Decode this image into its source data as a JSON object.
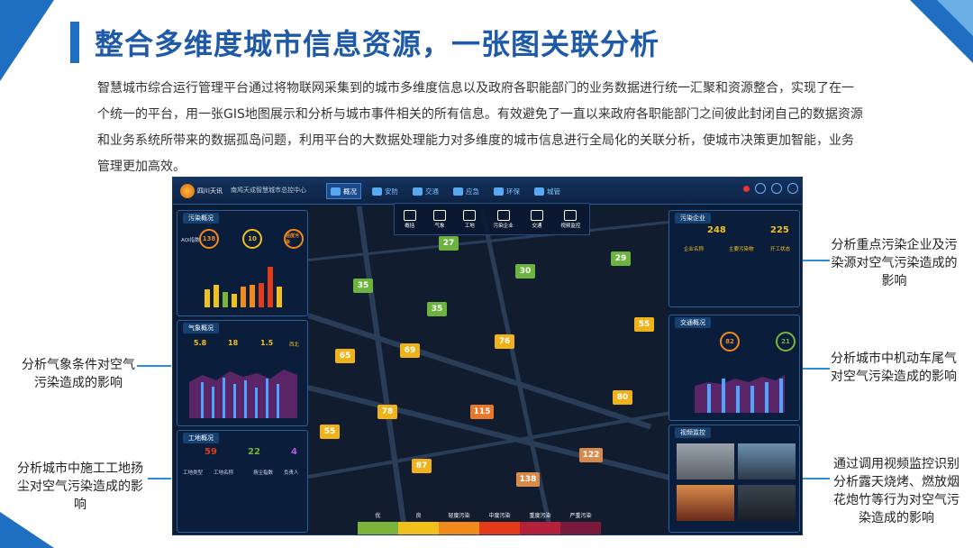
{
  "title": "整合多维度城市信息资源，一张图关联分析",
  "intro": "智慧城市综合运行管理平台通过将物联网采集到的城市多维度信息以及政府各职能部门的业务数据进行统一汇聚和资源整合，实现了在一个统一的平台，用一张GIS地图展示和分析与城市事件相关的所有信息。有效避免了一直以来政府各职能部门之间彼此封闭自己的数据资源和业务系统所带来的数据孤岛问题，利用平台的大数据处理能力对多维度的城市信息进行全局化的关联分析，使城市决策更加智能，业务管理更加高效。",
  "annotations": {
    "weather": "分析气象条件对空气污染造成的影响",
    "construction": "分析城市中施工工地扬尘对空气污染造成的影响",
    "enterprise": "分析重点污染企业及污染源对空气污染造成的影响",
    "traffic": "分析城市中机动车尾气对空气污染造成的影响",
    "video": "通过调用视频监控识别分析露天烧烤、燃放烟花炮竹等行为对空气污染造成的影响"
  },
  "dashboard": {
    "logo_text": "四川天讯",
    "system_name": "南鸠天成智慧城市总控中心",
    "nav": [
      {
        "label": "概况",
        "active": true
      },
      {
        "label": "安防",
        "active": false
      },
      {
        "label": "交通",
        "active": false
      },
      {
        "label": "应急",
        "active": false
      },
      {
        "label": "环保",
        "active": false
      },
      {
        "label": "城管",
        "active": false
      }
    ],
    "tools": [
      "概括",
      "气象",
      "工地",
      "污染企业",
      "交通",
      "视频监控"
    ],
    "panels": {
      "pollution": {
        "title": "污染概况",
        "aqi_label": "AQI指数",
        "aqi": "138",
        "pm_label": "PM",
        "pm": "10",
        "pm2_label": "首要污染物",
        "light_label": "轻度污染"
      },
      "weather": {
        "title": "气象概况",
        "humidity": "5.8",
        "humidity_unit": "%",
        "temp": "18",
        "temp_unit": "℃",
        "wind": "1.5",
        "wind_unit": "m/s",
        "wind_dir": "西北"
      },
      "construction": {
        "title": "工地概况",
        "v1": "59",
        "v2": "22",
        "v3": "4",
        "cols": [
          "工地类型",
          "工地名称",
          "扬尘指数",
          "负责人"
        ]
      },
      "enterprise": {
        "title": "污染企业",
        "n1": "248",
        "n2": "225",
        "cols": [
          "企业名称",
          "主要污染物",
          "开工状态"
        ]
      },
      "traffic": {
        "title": "交通概况",
        "v1": "82",
        "v2": "21"
      },
      "video": {
        "title": "视频监控"
      }
    },
    "markers": [
      "27",
      "30",
      "29",
      "35",
      "35",
      "55",
      "65",
      "69",
      "76",
      "80",
      "78",
      "115",
      "55",
      "87",
      "122",
      "138"
    ],
    "legend": [
      "优",
      "良",
      "轻度污染",
      "中度污染",
      "重度污染",
      "严重污染"
    ],
    "legend_colors": [
      "#7ab43a",
      "#f2c01a",
      "#f08a1a",
      "#e33a1a",
      "#b3213a",
      "#7a1a3a"
    ]
  }
}
